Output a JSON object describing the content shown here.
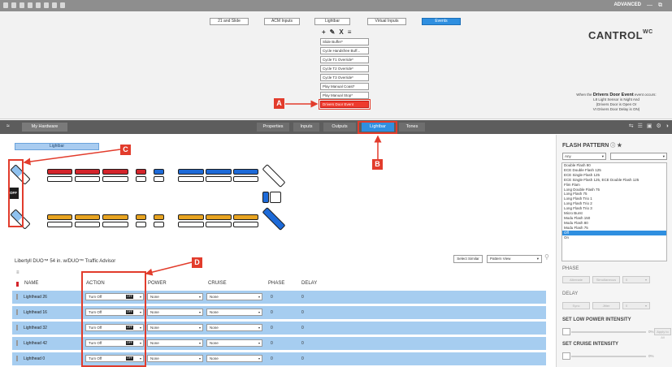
{
  "window": {
    "mode_label": "ADVANCED",
    "minimize_glyph": "—",
    "restore_glyph": "⧉"
  },
  "top_tabs": [
    {
      "label": "21 and Slide",
      "active": false
    },
    {
      "label": "ACM Inputs",
      "active": false
    },
    {
      "label": "Lightbar",
      "active": false
    },
    {
      "label": "Virtual Inputs",
      "active": false
    },
    {
      "label": "Events",
      "active": true
    }
  ],
  "event_tools": {
    "add": "+",
    "edit": "✎",
    "delete": "X",
    "list": "≡"
  },
  "events": [
    "Slide Buffer*",
    "Cycle Handsfree Buff...",
    "Cycle T1 Override*",
    "Cycle T2 Override*",
    "Cycle T3 Override*",
    "Play Manual Coast*",
    "Play Manual Stop*",
    "Drivers Door Event"
  ],
  "logo": {
    "text": "CANTROL",
    "sup": "WC"
  },
  "event_desc": {
    "prefix": "When the",
    "event_name": "Drivers Door Event",
    "suffix": "event occurs:",
    "line1": "L8 Light Sensor is Night And",
    "line2": "(Drivers Door is Open Or",
    "line3": "VI Drivers Door Delay is ON)"
  },
  "toolbar": {
    "collapse_glyph": "≈",
    "my_hardware": "My Hardware",
    "tabs": [
      {
        "label": "Properties",
        "active": false
      },
      {
        "label": "Inputs",
        "active": false
      },
      {
        "label": "Outputs",
        "active": false
      },
      {
        "label": "Lightbar",
        "active": true
      },
      {
        "label": "Tones",
        "active": false
      }
    ]
  },
  "canvas": {
    "lightbar_button": "Lightbar",
    "off_label": "OFF"
  },
  "product_title": "Libertyll DUO™ 54 in. w/DUO™ Traffic Advisor",
  "select_similar": "Select Similar",
  "pattern_view": "Pattern View",
  "grid": {
    "columns": [
      "NAME",
      "ACTION",
      "POWER",
      "CRUISE",
      "PHASE",
      "DELAY"
    ],
    "rows": [
      {
        "name": "Lighthead 26",
        "flag": "#d4242b",
        "action": "Turn Off",
        "power": "None",
        "cruise": "None",
        "phase": "0",
        "delay": "0"
      },
      {
        "name": "Lighthead 16",
        "flag": "#d4242b",
        "action": "Turn Off",
        "power": "None",
        "cruise": "None",
        "phase": "0",
        "delay": "0"
      },
      {
        "name": "Lighthead 32",
        "flag": "#ffffff",
        "action": "Turn Off",
        "power": "None",
        "cruise": "None",
        "phase": "0",
        "delay": "0"
      },
      {
        "name": "Lighthead 42",
        "flag": "#ffffff",
        "action": "Turn Off",
        "power": "None",
        "cruise": "None",
        "phase": "0",
        "delay": "0"
      },
      {
        "name": "Lighthead 0",
        "flag": "#d4242b",
        "action": "Turn Off",
        "power": "None",
        "cruise": "None",
        "phase": "0",
        "delay": "0"
      }
    ],
    "off_badge": "OFF"
  },
  "flash_pattern": {
    "title": "FLASH PATTERN",
    "filter": "Any",
    "items": [
      "Double Flash 90",
      "ECE Double Flash 125",
      "ECE Single Flash 125",
      "ECE Single Flash 125, ECE Double Flash 125",
      "Flim Flam",
      "Long Double Flash 75",
      "Long Flash 75",
      "Long Flash Trio 1",
      "Long Flash Trio 2",
      "Long Flash Trio 3",
      "Micro Burst",
      "Modu Flash 150",
      "Modu Flash 80",
      "Modu Flash 75",
      "Off",
      "On"
    ],
    "selected": "Off"
  },
  "phase": {
    "label": "PHASE",
    "btn1": "Alternate",
    "btn2": "Simultaneous",
    "value": "0"
  },
  "delay": {
    "label": "DELAY",
    "btn1": "Sync",
    "btn2": "Jitter",
    "value": "0"
  },
  "low_power": {
    "label": "SET LOW POWER INTENSITY",
    "value": "0%",
    "apply": "Apply to All"
  },
  "cruise": {
    "label": "SET CRUISE INTENSITY",
    "value": "0%"
  },
  "callouts": {
    "a": "A",
    "b": "B",
    "c": "C",
    "d": "D"
  },
  "colors": {
    "accent": "#2f8fe0",
    "callout": "#e23c2c",
    "row_fill": "#a6cdf0"
  }
}
